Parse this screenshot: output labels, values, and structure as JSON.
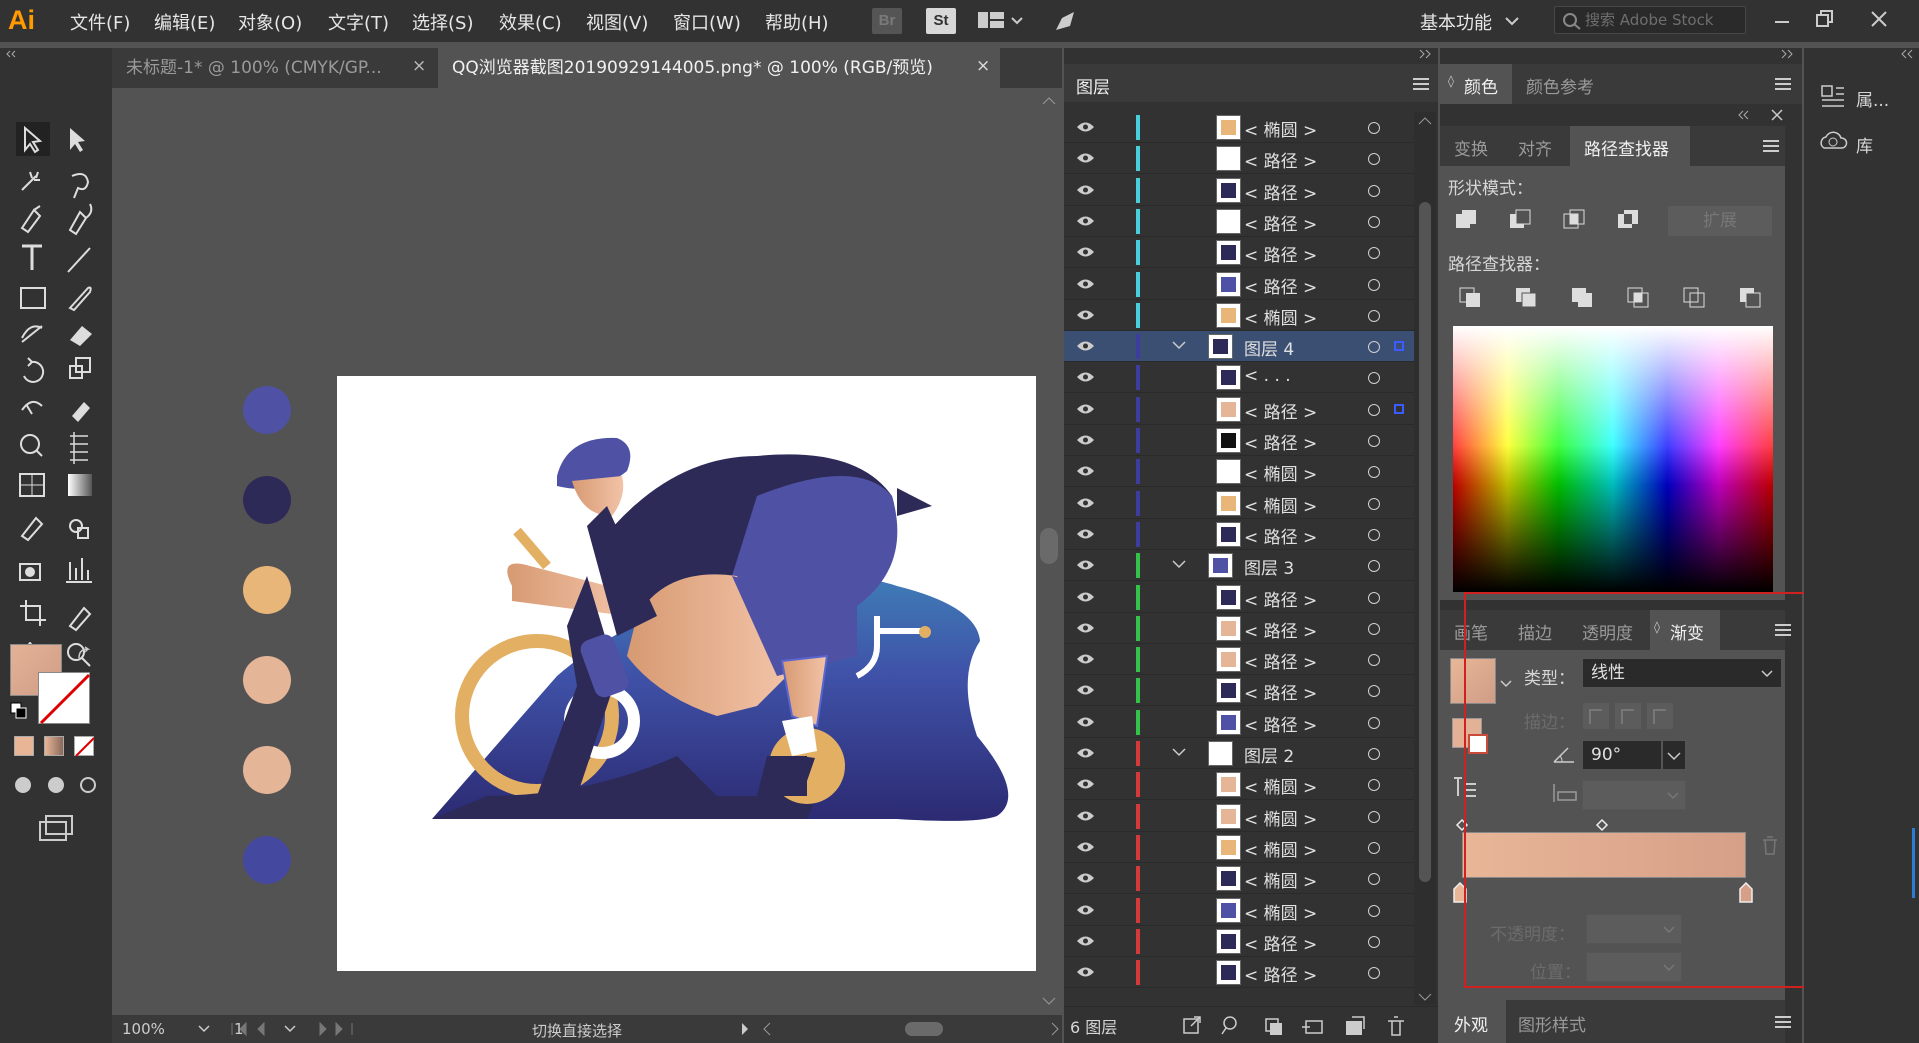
{
  "app": {
    "logo": "Ai",
    "workspace": "基本功能",
    "search_placeholder": "搜索 Adobe Stock"
  },
  "menu": [
    "文件(F)",
    "编辑(E)",
    "对象(O)",
    "文字(T)",
    "选择(S)",
    "效果(C)",
    "视图(V)",
    "窗口(W)",
    "帮助(H)"
  ],
  "menu_buttons": {
    "br": "Br",
    "st": "St"
  },
  "tabs": [
    {
      "label": "未标题-1* @ 100% (CMYK/GP...",
      "close": "×"
    },
    {
      "label": "QQ浏览器截图20190929144005.png* @ 100% (RGB/预览)",
      "close": "×"
    }
  ],
  "status": {
    "zoom": "100%",
    "page": "1",
    "hint": "切换直接选择"
  },
  "swatch_colors": [
    "#4f52a4",
    "#2d2a58",
    "#e9b679",
    "#e5b597",
    "#e5b597",
    "#44489e"
  ],
  "layers_panel": {
    "title": "图层",
    "footer": "6 图层",
    "rows": [
      {
        "name": "< 椭圆 >",
        "bar": "#47d0dc",
        "thumb": "#e9b679"
      },
      {
        "name": "< 路径 >",
        "bar": "#47d0dc",
        "thumb": "#ffffff"
      },
      {
        "name": "< 路径 >",
        "bar": "#47d0dc",
        "thumb": "#2d2a58"
      },
      {
        "name": "< 路径 >",
        "bar": "#47d0dc",
        "thumb": "#ffffff"
      },
      {
        "name": "< 路径 >",
        "bar": "#47d0dc",
        "thumb": "#2d2a58"
      },
      {
        "name": "< 路径 >",
        "bar": "#47d0dc",
        "thumb": "#4f52a4"
      },
      {
        "name": "< 椭圆 >",
        "bar": "#47d0dc",
        "thumb": "#e9b679"
      },
      {
        "name": "图层 4",
        "bar": "#3d3d9e",
        "thumb": "#2d2a58",
        "group": true
      },
      {
        "name": "< . . .",
        "bar": "#3d3d9e",
        "thumb": "#2d2a58"
      },
      {
        "name": "< 路径 >",
        "bar": "#3d3d9e",
        "thumb": "#e5b597"
      },
      {
        "name": "< 路径 >",
        "bar": "#3d3d9e",
        "thumb": "#111111"
      },
      {
        "name": "< 椭圆 >",
        "bar": "#3d3d9e",
        "thumb": "#ffffff"
      },
      {
        "name": "< 椭圆 >",
        "bar": "#3d3d9e",
        "thumb": "#e9b679"
      },
      {
        "name": "< 路径 >",
        "bar": "#3d3d9e",
        "thumb": "#2d2a58"
      },
      {
        "name": "图层 3",
        "bar": "#34c24a",
        "thumb": "#4f52a4",
        "group": true
      },
      {
        "name": "< 路径 >",
        "bar": "#34c24a",
        "thumb": "#2d2a58"
      },
      {
        "name": "< 路径 >",
        "bar": "#34c24a",
        "thumb": "#e5b597"
      },
      {
        "name": "< 路径 >",
        "bar": "#34c24a",
        "thumb": "#e5b597"
      },
      {
        "name": "< 路径 >",
        "bar": "#34c24a",
        "thumb": "#2d2a58"
      },
      {
        "name": "< 路径 >",
        "bar": "#34c24a",
        "thumb": "#4f52a4"
      },
      {
        "name": "图层 2",
        "bar": "#d43a3a",
        "thumb": "#ffffff",
        "group": true
      },
      {
        "name": "< 椭圆 >",
        "bar": "#d43a3a",
        "thumb": "#e5b597"
      },
      {
        "name": "< 椭圆 >",
        "bar": "#d43a3a",
        "thumb": "#e5b597"
      },
      {
        "name": "< 椭圆 >",
        "bar": "#d43a3a",
        "thumb": "#e9b679"
      },
      {
        "name": "< 椭圆 >",
        "bar": "#d43a3a",
        "thumb": "#2d2a58"
      },
      {
        "name": "< 椭圆 >",
        "bar": "#d43a3a",
        "thumb": "#4f52a4"
      },
      {
        "name": "< 路径 >",
        "bar": "#d43a3a",
        "thumb": "#2d2a58"
      },
      {
        "name": "< 路径 >",
        "bar": "#d43a3a",
        "thumb": "#2d2a58"
      }
    ]
  },
  "color_panel": {
    "tab_color": "颜色",
    "tab_guide": "颜色参考"
  },
  "pathfinder_panel": {
    "tabs": [
      "变换",
      "对齐",
      "路径查找器"
    ],
    "shape_modes": "形状模式：",
    "expand": "扩展",
    "pathfinders": "路径查找器："
  },
  "gradient_panel": {
    "tabs": [
      "画笔",
      "描边",
      "透明度",
      "渐变"
    ],
    "type_label": "类型：",
    "type_value": "线性",
    "stroke_label": "描边：",
    "angle_value": "90°",
    "opacity_label": "不透明度：",
    "position_label": "位置：",
    "gradient_start": "#e8b697",
    "gradient_end": "#d69f88"
  },
  "bottom_panel": {
    "tabs": [
      "外观",
      "图形样式"
    ]
  },
  "far_right": {
    "properties": "属...",
    "libraries": "库"
  }
}
